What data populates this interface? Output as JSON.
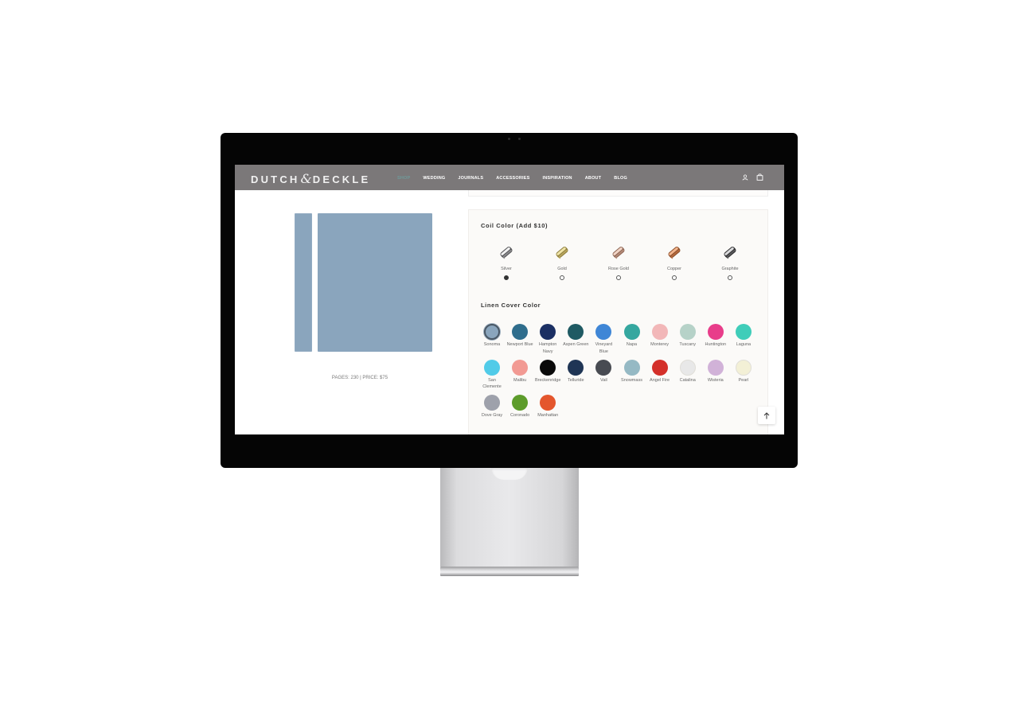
{
  "header": {
    "logo_left": "DUTCH",
    "logo_amp": "&",
    "logo_right": "DECKLE",
    "nav": [
      {
        "label": "SHOP",
        "active": true
      },
      {
        "label": "WEDDING",
        "active": false
      },
      {
        "label": "JOURNALS",
        "active": false
      },
      {
        "label": "ACCESSORIES",
        "active": false
      },
      {
        "label": "INSPIRATION",
        "active": false
      },
      {
        "label": "ABOUT",
        "active": false
      },
      {
        "label": "BLOG",
        "active": false
      }
    ],
    "icons": {
      "account": "user-icon",
      "cart": "shopping-bag-icon"
    }
  },
  "product": {
    "info": "PAGES: 230 | PRICE: $75",
    "cover_color": "#8aa5bd"
  },
  "coil": {
    "title": "Coil Color (Add $10)",
    "options": [
      {
        "name": "Silver",
        "selected": true,
        "colors": [
          "#4f4f52",
          "#f2f2f2",
          "#8a8a8c"
        ]
      },
      {
        "name": "Gold",
        "selected": false,
        "colors": [
          "#8c7d3c",
          "#efe3a6",
          "#b8a55c"
        ]
      },
      {
        "name": "Rose Gold",
        "selected": false,
        "colors": [
          "#8c6453",
          "#f1d4c5",
          "#b38a77"
        ]
      },
      {
        "name": "Copper",
        "selected": false,
        "colors": [
          "#8a4d2a",
          "#f2b48c",
          "#b56a3d"
        ]
      },
      {
        "name": "Graphite",
        "selected": false,
        "colors": [
          "#2b2b2d",
          "#d9d9db",
          "#5a5a5c"
        ]
      }
    ]
  },
  "linen": {
    "title": "Linen Cover Color",
    "options": [
      {
        "name": "Sonoma",
        "color": "#8aa5bd",
        "selected": true
      },
      {
        "name": "Newport Blue",
        "color": "#2f6d8c",
        "selected": false
      },
      {
        "name": "Hampton Navy",
        "color": "#1b2f63",
        "selected": false
      },
      {
        "name": "Aspen Green",
        "color": "#1f5a63",
        "selected": false
      },
      {
        "name": "Vineyard Blue",
        "color": "#3f86d6",
        "selected": false
      },
      {
        "name": "Napa",
        "color": "#35a79f",
        "selected": false
      },
      {
        "name": "Monterey",
        "color": "#f2b7b8",
        "selected": false
      },
      {
        "name": "Tuscany",
        "color": "#b6d2c8",
        "selected": false
      },
      {
        "name": "Huntington",
        "color": "#e83d8a",
        "selected": false
      },
      {
        "name": "Laguna",
        "color": "#3fcdb9",
        "selected": false
      },
      {
        "name": "San Clemente",
        "color": "#51cbe8",
        "selected": false
      },
      {
        "name": "Malibu",
        "color": "#f29a93",
        "selected": false
      },
      {
        "name": "Breckenridge",
        "color": "#0a0a0a",
        "selected": false
      },
      {
        "name": "Telluride",
        "color": "#1f3555",
        "selected": false
      },
      {
        "name": "Vail",
        "color": "#484b52",
        "selected": false
      },
      {
        "name": "Snowmass",
        "color": "#95b9c4",
        "selected": false
      },
      {
        "name": "Angel Fire",
        "color": "#d4302a",
        "selected": false
      },
      {
        "name": "Catalina",
        "color": "#e8e8e8",
        "selected": false
      },
      {
        "name": "Wisteria",
        "color": "#d1b2d8",
        "selected": false
      },
      {
        "name": "Pearl",
        "color": "#f3f0d6",
        "selected": false
      },
      {
        "name": "Dove Gray",
        "color": "#9ea1ab",
        "selected": false
      },
      {
        "name": "Coronado",
        "color": "#5d9c2b",
        "selected": false
      },
      {
        "name": "Manhattan",
        "color": "#e4562d",
        "selected": false
      }
    ]
  },
  "scroll_top": {
    "icon": "arrow-up-icon"
  }
}
